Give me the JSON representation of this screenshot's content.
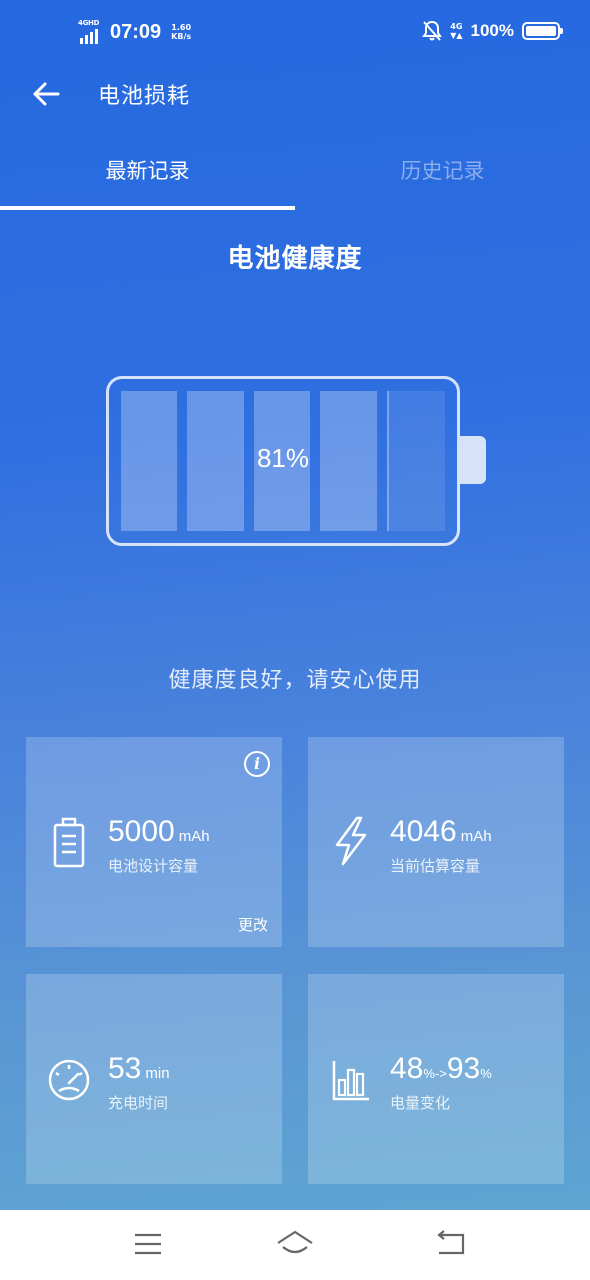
{
  "status_bar": {
    "network_tag": "4GHD",
    "time": "07:09",
    "speed_value": "1.60",
    "speed_unit": "KB/s",
    "net_4g": "4G",
    "battery_percent": "100%"
  },
  "app_bar": {
    "title": "电池损耗"
  },
  "tabs": [
    {
      "label": "最新记录",
      "active": true
    },
    {
      "label": "历史记录",
      "active": false
    }
  ],
  "section_title": "电池健康度",
  "battery": {
    "health_label": "81%",
    "health_fraction": 0.81,
    "filled_cells": 4,
    "total_cells": 5
  },
  "health_message": "健康度良好，请安心使用",
  "cards": {
    "design_capacity": {
      "value": "5000",
      "unit": "mAh",
      "label": "电池设计容量",
      "action": "更改",
      "icon": "battery-outline-icon"
    },
    "estimated_capacity": {
      "value": "4046",
      "unit": "mAh",
      "label": "当前估算容量",
      "icon": "lightning-icon"
    },
    "charge_time": {
      "value": "53",
      "unit": "min",
      "label": "充电时间",
      "icon": "speedometer-icon"
    },
    "level_change": {
      "from": "48",
      "from_unit": "%->",
      "to": "93",
      "to_unit": "%",
      "label": "电量变化",
      "icon": "bar-chart-icon"
    }
  },
  "colors": {
    "bg_top": "#2568e0",
    "bg_bottom": "#5ea6d2",
    "nav_bg": "#ffffff",
    "nav_icon": "#666666"
  }
}
